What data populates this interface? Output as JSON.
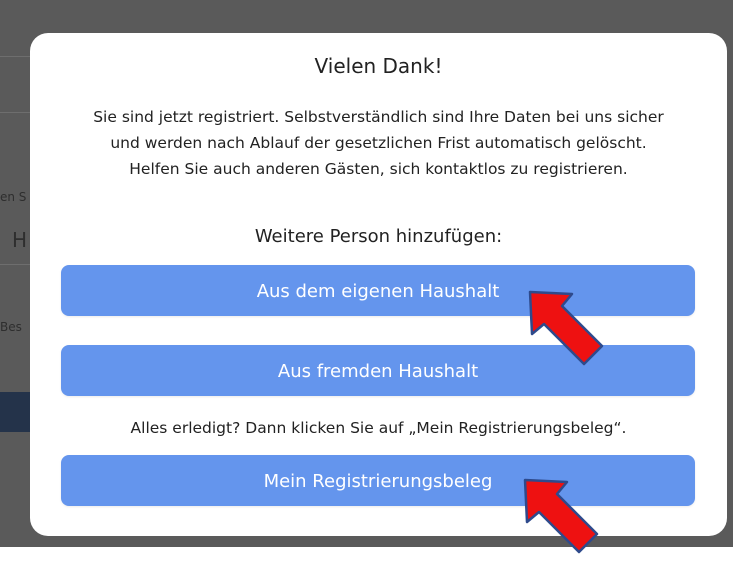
{
  "background": {
    "fragment_1": "en S",
    "fragment_2": "H",
    "fragment_3": "Bes"
  },
  "dialog": {
    "title": "Vielen Dank!",
    "message_line1": "Sie sind jetzt registriert. Selbstverständlich sind Ihre Daten bei uns sicher",
    "message_line2": "und werden nach Ablauf der gesetzlichen Frist automatisch gelöscht.",
    "message_line3": "Helfen Sie auch anderen Gästen, sich kontaktlos zu registrieren.",
    "add_person_heading": "Weitere Person hinzufügen:",
    "own_household_button": "Aus dem eigenen Haushalt",
    "other_household_button": "Aus fremden Haushalt",
    "done_hint": "Alles erledigt? Dann klicken Sie auf „Mein Registrierungsbeleg“.",
    "receipt_button": "Mein Registrierungsbeleg"
  },
  "colors": {
    "overlay": "#4d4d4d",
    "button": "#6495ed",
    "arrow_fill": "#ee1111",
    "arrow_outline": "#2e4a8c"
  }
}
